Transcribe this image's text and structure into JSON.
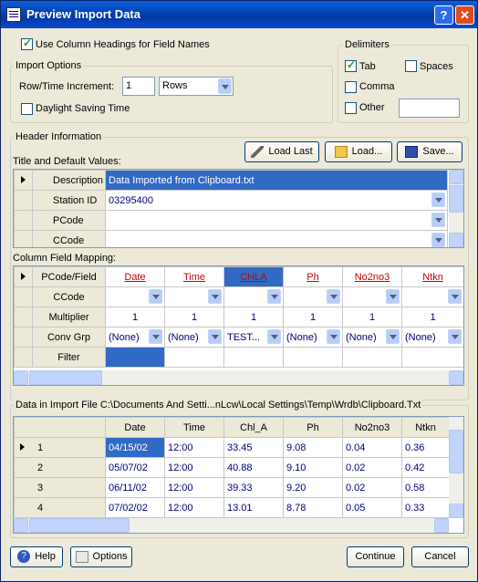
{
  "window": {
    "title": "Preview Import Data"
  },
  "use_headings": {
    "label": "Use Column Headings for Field Names",
    "checked": true
  },
  "import_options": {
    "title": "Import Options",
    "row_increment_label": "Row/Time Increment:",
    "row_increment_value": "1",
    "row_increment_unit": "Rows",
    "daylight_label": "Daylight Saving Time",
    "daylight_checked": false
  },
  "delimiters": {
    "title": "Delimiters",
    "tab": {
      "label": "Tab",
      "checked": true
    },
    "spaces": {
      "label": "Spaces",
      "checked": false
    },
    "comma": {
      "label": "Comma",
      "checked": false
    },
    "other": {
      "label": "Other",
      "checked": false,
      "value": ""
    }
  },
  "header_info": {
    "title": "Header Information",
    "title_defaults_label": "Title and Default Values:",
    "load_last": "Load Last",
    "load": "Load...",
    "save": "Save...",
    "rows": [
      {
        "label": "Description",
        "value": "Data Imported from Clipboard.txt"
      },
      {
        "label": "Station ID",
        "value": "03295400"
      },
      {
        "label": "PCode",
        "value": ""
      },
      {
        "label": "CCode",
        "value": ""
      }
    ]
  },
  "mapping": {
    "title": "Column Field Mapping:",
    "row_labels": [
      "PCode/Field",
      "CCode",
      "Multiplier",
      "Conv Grp",
      "Filter"
    ],
    "fields": [
      "Date",
      "Time",
      "CHLA",
      "Ph",
      "No2no3",
      "Ntkn"
    ],
    "multipliers": [
      "1",
      "1",
      "1",
      "1",
      "1",
      "1"
    ],
    "conv_grps": [
      "(None)",
      "(None)",
      "TEST...",
      "(None)",
      "(None)",
      "(None)"
    ]
  },
  "import_file": {
    "title": "Data in Import File C:\\Documents And Setti...nLcw\\Local Settings\\Temp\\Wrdb\\Clipboard.Txt",
    "columns": [
      "Date",
      "Time",
      "Chl_A",
      "Ph",
      "No2no3",
      "Ntkn"
    ],
    "rows": [
      {
        "n": "1",
        "cells": [
          "04/15/02",
          "12:00",
          "33.45",
          "9.08",
          "0.04",
          "0.36"
        ]
      },
      {
        "n": "2",
        "cells": [
          "05/07/02",
          "12:00",
          "40.88",
          "9.10",
          "0.02",
          "0.42"
        ]
      },
      {
        "n": "3",
        "cells": [
          "06/11/02",
          "12:00",
          "39.33",
          "9.20",
          "0.02",
          "0.58"
        ]
      },
      {
        "n": "4",
        "cells": [
          "07/02/02",
          "12:00",
          "13.01",
          "8.78",
          "0.05",
          "0.33"
        ]
      }
    ]
  },
  "footer": {
    "help": "Help",
    "options": "Options",
    "continue": "Continue",
    "cancel": "Cancel"
  }
}
